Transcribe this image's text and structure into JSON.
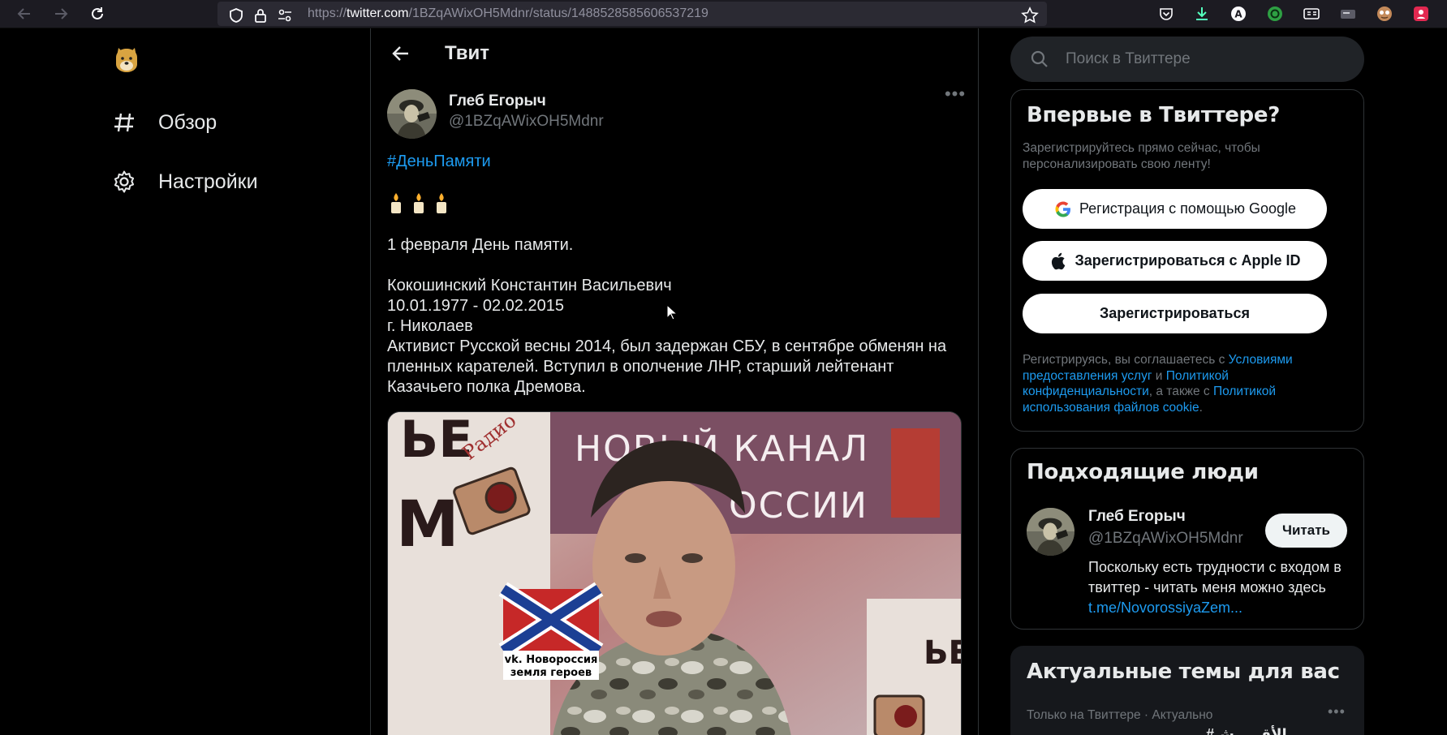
{
  "browser": {
    "url_scheme": "https://",
    "url_host": "twitter.com",
    "url_path": "/1BZqAWixOH5Mdnr/status/1488528585606537219"
  },
  "sidebar": {
    "items": [
      {
        "label": "Обзор",
        "icon": "hashtag-icon"
      },
      {
        "label": "Настройки",
        "icon": "gear-icon"
      }
    ]
  },
  "main": {
    "title": "Твит",
    "tweet": {
      "author_name": "Глеб Егорыч",
      "author_handle": "@1BZqAWixOH5Mdnr",
      "hashtag": "#ДеньПамяти",
      "lines": [
        "1 февраля День памяти.",
        "Кокошинский Константин Васильевич",
        "10.01.1977 - 02.02.2015",
        "г. Николаев",
        "Активист Русской весны 2014, был задержан СБУ, в сентябре обменян на пленных карателей. Вступил в ополчение ЛНР, старший лейтенант Казачьего полка Дремова."
      ],
      "media": {
        "banner_top": "НОВЫЙ КАНАЛ",
        "banner_bottom": "ОССИИ",
        "left_text_1": "ЬЕ",
        "left_text_2": "М",
        "radio_word": "Радио",
        "flag_caption_1": "vk. Новороссия",
        "flag_caption_2": "земля героев"
      }
    }
  },
  "search": {
    "placeholder": "Поиск в Твиттере"
  },
  "signup": {
    "title": "Впервые в Твиттере?",
    "subtitle": "Зарегистрируйтесь прямо сейчас, чтобы персонализировать свою ленту!",
    "google_label": "Регистрация с помощью Google",
    "apple_label": "Зарегистрироваться с Apple ID",
    "register_label": "Зарегистрироваться",
    "terms_prefix": "Регистрируясь, вы соглашаетесь с ",
    "terms_link": "Условиями предоставления услуг",
    "terms_and": " и ",
    "privacy_link": "Политикой конфиденциальности",
    "terms_also": ", а также с ",
    "cookie_link": "Политикой использования файлов cookie",
    "terms_end": "."
  },
  "people": {
    "title": "Подходящие люди",
    "name": "Глеб Егорыч",
    "handle": "@1BZqAWixOH5Mdnr",
    "follow_label": "Читать",
    "bio": "Поскольку есть трудности с входом в твиттер - читать меня можно здесь",
    "bio_link": "t.me/NovorossiyaZem..."
  },
  "trends": {
    "title": "Актуальные темы для вас",
    "meta": "Только на Твиттере · Актуально",
    "peek": "#الأقـ ـ ـ ش"
  },
  "colors": {
    "accent": "#1d9bf0",
    "background": "#000000",
    "border": "#2f3336",
    "secondary_text": "#71767b"
  }
}
